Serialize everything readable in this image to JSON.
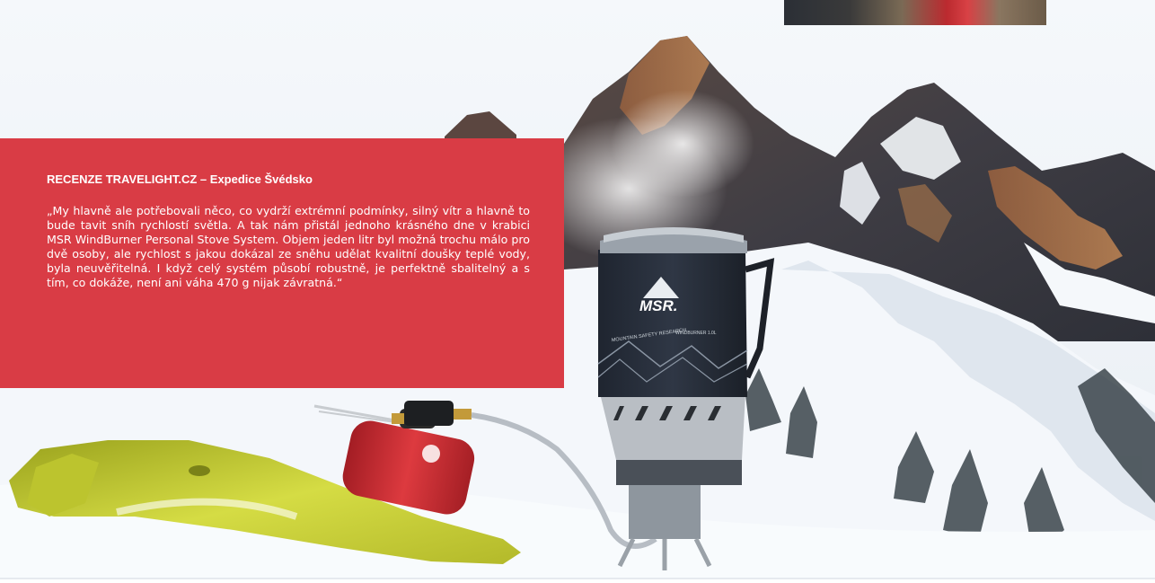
{
  "review": {
    "title": "RECENZE TRAVELIGHT.CZ – Expedice Švédsko",
    "quote": "„My hlavně ale potřebovali něco, co vydrží extrémní podmínky, silný vítr a hlavně to bude tavit sníh rychlostí světla. A tak nám přistál jednoho krásného dne v krabici MSR WindBurner Personal Stove System. Objem jeden litr byl možná trochu málo pro dvě osoby, ale rychlost s jakou dokázal ze sněhu udělat kvalitní doušky teplé vody, byla neuvěřitelná. I když celý systém působí robustně, je perfektně sbalitelný a s tím, co dokáže, není ani váha 470 g nijak závratná.“"
  },
  "product": {
    "brand": "MSR.",
    "subbrand": "MOUNTAIN SAFETY RESEARCH",
    "model": "WINDBURNER 1.0L"
  },
  "colors": {
    "card": "#d93c45",
    "snow": "#f4f7fb",
    "sky": "#eef3f8",
    "canister": "#cc2a30",
    "pad": "#c9d23a"
  }
}
